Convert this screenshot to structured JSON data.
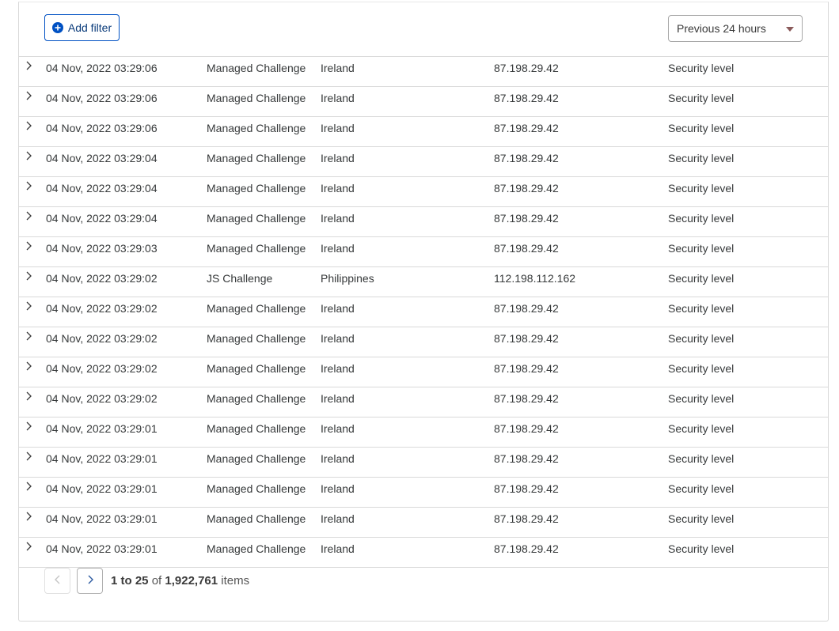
{
  "toolbar": {
    "add_filter_label": "Add filter",
    "add_filter_icon": "plus-circle-icon",
    "time_range": "Previous 24 hours"
  },
  "events": [
    {
      "date": "04 Nov, 2022 03:29:06",
      "action": "Managed Challenge",
      "country": "Ireland",
      "ip": "87.198.29.42",
      "service": "Security level"
    },
    {
      "date": "04 Nov, 2022 03:29:06",
      "action": "Managed Challenge",
      "country": "Ireland",
      "ip": "87.198.29.42",
      "service": "Security level"
    },
    {
      "date": "04 Nov, 2022 03:29:06",
      "action": "Managed Challenge",
      "country": "Ireland",
      "ip": "87.198.29.42",
      "service": "Security level"
    },
    {
      "date": "04 Nov, 2022 03:29:04",
      "action": "Managed Challenge",
      "country": "Ireland",
      "ip": "87.198.29.42",
      "service": "Security level"
    },
    {
      "date": "04 Nov, 2022 03:29:04",
      "action": "Managed Challenge",
      "country": "Ireland",
      "ip": "87.198.29.42",
      "service": "Security level"
    },
    {
      "date": "04 Nov, 2022 03:29:04",
      "action": "Managed Challenge",
      "country": "Ireland",
      "ip": "87.198.29.42",
      "service": "Security level"
    },
    {
      "date": "04 Nov, 2022 03:29:03",
      "action": "Managed Challenge",
      "country": "Ireland",
      "ip": "87.198.29.42",
      "service": "Security level"
    },
    {
      "date": "04 Nov, 2022 03:29:02",
      "action": "JS Challenge",
      "country": "Philippines",
      "ip": "112.198.112.162",
      "service": "Security level"
    },
    {
      "date": "04 Nov, 2022 03:29:02",
      "action": "Managed Challenge",
      "country": "Ireland",
      "ip": "87.198.29.42",
      "service": "Security level"
    },
    {
      "date": "04 Nov, 2022 03:29:02",
      "action": "Managed Challenge",
      "country": "Ireland",
      "ip": "87.198.29.42",
      "service": "Security level"
    },
    {
      "date": "04 Nov, 2022 03:29:02",
      "action": "Managed Challenge",
      "country": "Ireland",
      "ip": "87.198.29.42",
      "service": "Security level"
    },
    {
      "date": "04 Nov, 2022 03:29:02",
      "action": "Managed Challenge",
      "country": "Ireland",
      "ip": "87.198.29.42",
      "service": "Security level"
    },
    {
      "date": "04 Nov, 2022 03:29:01",
      "action": "Managed Challenge",
      "country": "Ireland",
      "ip": "87.198.29.42",
      "service": "Security level"
    },
    {
      "date": "04 Nov, 2022 03:29:01",
      "action": "Managed Challenge",
      "country": "Ireland",
      "ip": "87.198.29.42",
      "service": "Security level"
    },
    {
      "date": "04 Nov, 2022 03:29:01",
      "action": "Managed Challenge",
      "country": "Ireland",
      "ip": "87.198.29.42",
      "service": "Security level"
    },
    {
      "date": "04 Nov, 2022 03:29:01",
      "action": "Managed Challenge",
      "country": "Ireland",
      "ip": "87.198.29.42",
      "service": "Security level"
    },
    {
      "date": "04 Nov, 2022 03:29:01",
      "action": "Managed Challenge",
      "country": "Ireland",
      "ip": "87.198.29.42",
      "service": "Security level"
    }
  ],
  "pagination": {
    "range": "1 to 25",
    "of_label": "of",
    "total": "1,922,761",
    "items_label": "items",
    "prev_icon": "chevron-left-icon",
    "next_icon": "chevron-right-icon"
  },
  "colors": {
    "accent": "#0051c3",
    "border": "#d9d9d9",
    "text": "#36393a"
  }
}
